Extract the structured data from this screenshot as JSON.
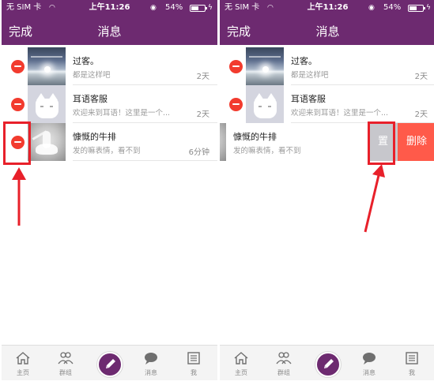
{
  "status_bar": {
    "carrier": "无 SIM 卡",
    "time": "上午11:26",
    "battery": "54%",
    "battery_level": 0.54
  },
  "nav": {
    "done_label": "完成",
    "title": "消息"
  },
  "messages": [
    {
      "name": "过客。",
      "preview": "都是这样吧",
      "time": "2天",
      "avatar": "sunset-sky-avatar"
    },
    {
      "name": "耳语客服",
      "preview": "欢迎来到耳语！这里是一个...",
      "time": "2天",
      "avatar": "white-cat-avatar"
    },
    {
      "name": "慷慨的牛排",
      "preview": "发的嘛表情，看不到",
      "time": "6分钟",
      "avatar": "dancer-avatar"
    }
  ],
  "swipe_actions": {
    "top_label": "置",
    "delete_label": "删除"
  },
  "tabs": [
    {
      "label": "主页",
      "icon": "home-icon"
    },
    {
      "label": "群组",
      "icon": "group-icon"
    },
    {
      "label": "",
      "icon": "compose-pencil-icon"
    },
    {
      "label": "消息",
      "icon": "chat-bubble-icon"
    },
    {
      "label": "我",
      "icon": "profile-list-icon"
    }
  ],
  "colors": {
    "brand": "#6d2a70",
    "delete": "#ff5a4a",
    "minus": "#f23b2e",
    "annotation": "#e8202a"
  }
}
